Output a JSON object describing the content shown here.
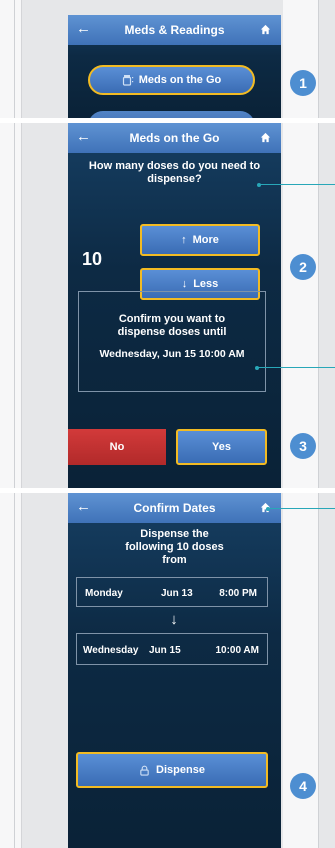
{
  "panel1": {
    "title": "Meds & Readings",
    "pill_label": "Meds on the Go",
    "step": "1"
  },
  "panel2": {
    "title": "Meds on the Go",
    "question": "How many doses do you need to dispense?",
    "count": "10",
    "more_label": "More",
    "less_label": "Less",
    "step_adjust": "2",
    "confirm_line1": "Confirm you want to",
    "confirm_line2": "dispense doses until",
    "confirm_date": "Wednesday, Jun 15 10:00 AM",
    "no_label": "No",
    "yes_label": "Yes",
    "step_confirm": "3"
  },
  "panel3": {
    "title": "Confirm Dates",
    "heading_line1": "Dispense the",
    "heading_line2": "following 10 doses",
    "heading_line3": "from",
    "from_day": "Monday",
    "from_date": "Jun 13",
    "from_time": "8:00 PM",
    "to_day": "Wednesday",
    "to_date": "Jun 15",
    "to_time": "10:00 AM",
    "dispense_label": "Dispense",
    "step": "4"
  },
  "colors": {
    "accent_blue": "#4d8ed1",
    "highlight_yellow": "#f2bb23",
    "no_red": "#c83232",
    "leader_teal": "#28a7b8"
  }
}
